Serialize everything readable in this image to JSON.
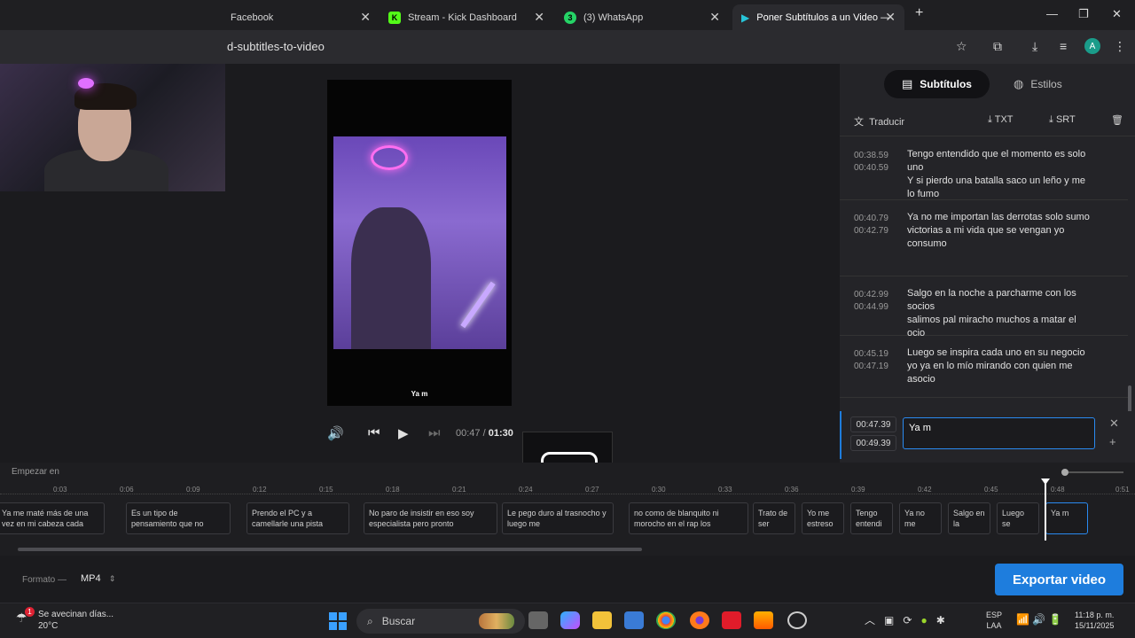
{
  "browser": {
    "tabs": [
      {
        "label": "Facebook",
        "icon": "facebook-icon"
      },
      {
        "label": "Stream - Kick Dashboard",
        "icon": "kick-icon"
      },
      {
        "label": "(3) WhatsApp",
        "icon": "whatsapp-icon"
      },
      {
        "label": "Poner Subtítulos a un Video —",
        "icon": "app-icon"
      }
    ],
    "url": "d-subtitles-to-video",
    "avatar_letter": "A"
  },
  "player": {
    "caption": "Ya m",
    "current_time": "00:47",
    "separator": "/",
    "duration": "01:30"
  },
  "overlay": {
    "keyboard_label": "abc"
  },
  "panel": {
    "tabs": [
      {
        "label": "Subtítulos"
      },
      {
        "label": "Estilos"
      }
    ],
    "tools": {
      "translate": "Traducir",
      "txt": "TXT",
      "srt": "SRT"
    },
    "subtitles": [
      {
        "start": "00:38.59",
        "end": "00:40.59",
        "text": "Tengo entendido que el momento es solo uno\nY si pierdo una batalla saco un leño y me lo fumo"
      },
      {
        "start": "00:40.79",
        "end": "00:42.79",
        "text": "Ya no me importan las derrotas solo sumo victorias a mi vida que se vengan yo consumo"
      },
      {
        "start": "00:42.99",
        "end": "00:44.99",
        "text": "Salgo en la noche a parcharme con los socios\nsalimos pal miracho muchos a matar el ocio"
      },
      {
        "start": "00:45.19",
        "end": "00:47.19",
        "text": "Luego se inspira cada uno en su negocio\nyo ya en lo mío mirando con quien me asocio"
      }
    ],
    "active": {
      "start": "00:47.39",
      "end": "00:49.39",
      "text": "Ya m"
    }
  },
  "timeline": {
    "label": "Empezar en",
    "ticks": [
      "0:03",
      "0:06",
      "0:09",
      "0:12",
      "0:15",
      "0:18",
      "0:21",
      "0:24",
      "0:27",
      "0:30",
      "0:33",
      "0:36",
      "0:39",
      "0:42",
      "0:45",
      "0:48",
      "0:51"
    ],
    "clips": [
      "Ya me maté más de una vez en mi cabeza cada",
      "Es un tipo de pensamiento que no",
      "Prendo el PC y a camellarle una pista",
      "No paro de insistir en eso soy especialista pero pronto",
      "Le pego duro al trasnocho y luego me",
      "no como de blanquito ni morocho en el rap los",
      "Trato de ser",
      "Yo me estreso",
      "Tengo entendi",
      "Ya no me",
      "Salgo en la",
      "Luego se",
      "Ya m"
    ]
  },
  "footer": {
    "format_label": "Formato —",
    "format_value": "MP4",
    "export_label": "Exportar video"
  },
  "taskbar": {
    "weather_title": "Se avecinan días...",
    "weather_temp": "20°C",
    "weather_badge": "1",
    "search": "Buscar",
    "lang_1": "ESP",
    "lang_2": "LAA",
    "time": "11:18 p. m.",
    "date": "15/11/2025"
  },
  "colors": {
    "accent": "#1e7ddd",
    "panel": "#242428",
    "background": "#1b1b1e"
  }
}
